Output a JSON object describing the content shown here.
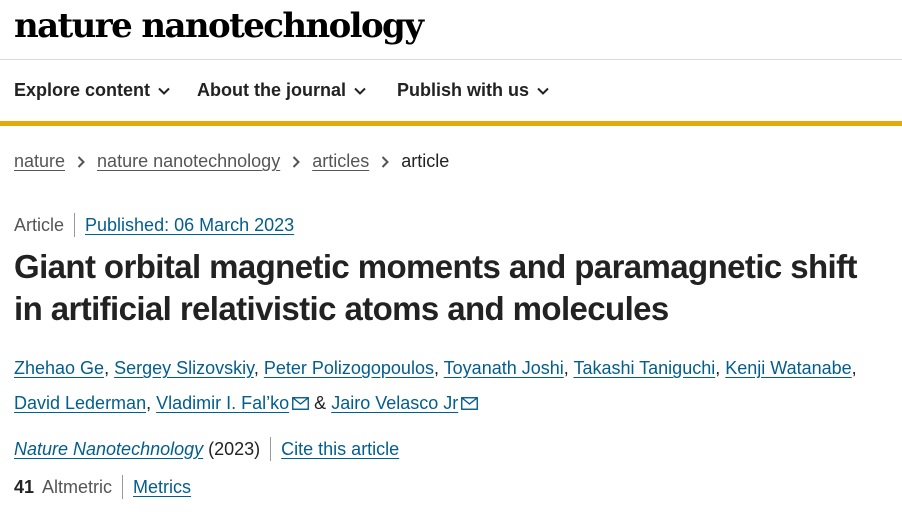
{
  "brand": {
    "logo": "nature nanotechnology"
  },
  "nav": {
    "items": [
      {
        "label": "Explore content"
      },
      {
        "label": "About the journal"
      },
      {
        "label": "Publish with us"
      }
    ]
  },
  "breadcrumb": {
    "items": [
      "nature",
      "nature nanotechnology",
      "articles"
    ],
    "current": "article"
  },
  "article": {
    "type": "Article",
    "published": "Published: 06 March 2023",
    "title": "Giant orbital magnetic moments and paramagnetic shift in artificial relativistic atoms and molecules",
    "authors": [
      "Zhehao Ge",
      "Sergey Slizovskiy",
      "Peter Polizogopoulos",
      "Toyanath Joshi",
      "Takashi Taniguchi",
      "Kenji Watanabe",
      "David Lederman",
      "Vladimir I. Fal’ko",
      "Jairo Velasco Jr"
    ],
    "author_separator": ",",
    "author_last_joiner": "&",
    "journal": "Nature Nanotechnology",
    "year": "(2023)",
    "cite": "Cite this article",
    "altmetric_count": "41",
    "altmetric_label": "Altmetric",
    "metrics": "Metrics"
  },
  "colors": {
    "accent": "#e8a711",
    "link": "#025e8d",
    "text": "#222222",
    "muted": "#555555"
  },
  "icons": {
    "nav_chevron": "chevron-down-icon",
    "crumb_separator": "chevron-right-icon",
    "corresponding_author": "mail-icon"
  }
}
